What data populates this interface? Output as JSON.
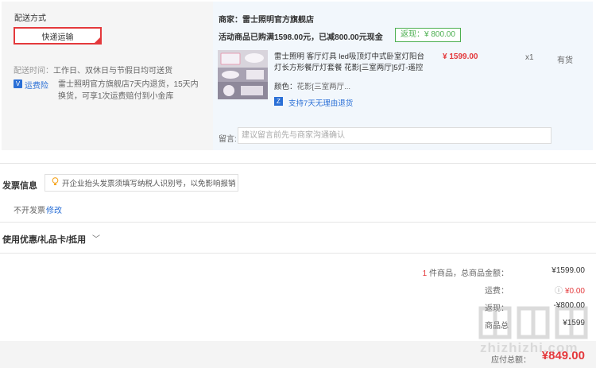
{
  "shipping": {
    "title": "配送方式",
    "method": "快递运输",
    "time_label": "配送时间：",
    "time_value": "工作日、双休日与节假日均可送货",
    "insurance_icon": "V",
    "insurance_label": "运费险",
    "insurance_desc": "雷士照明官方旗舰店7天内退货，15天内换货，可享1次运费赔付到小金库"
  },
  "shop": {
    "name": "商家：雷士照明官方旗舰店",
    "promo": "活动商品已购满1598.00元，已减800.00元现金",
    "rebate": "返现：¥ 800.00"
  },
  "product": {
    "name": "雷士照明 客厅灯具 led吸顶灯中式卧室灯阳台灯长方形餐厅灯套餐 花影[三室两厅]5灯-遥控",
    "color_label": "颜色：",
    "color_value": "花影[三室两厅...",
    "price": "¥ 1599.00",
    "qty": "x1",
    "stock": "有货",
    "return_icon": "Z",
    "return_text": "支持7天无理由退货"
  },
  "note": {
    "label": "留言:",
    "placeholder": "建议留言前先与商家沟通确认"
  },
  "invoice": {
    "title": "发票信息",
    "tip": "开企业抬头发票须填写纳税人识别号，以免影响报销",
    "value": "不开发票",
    "edit": "修改"
  },
  "coupon": {
    "title": "使用优惠/礼品卡/抵用",
    "arrow": "﹀"
  },
  "summary": {
    "count": "1",
    "count_suffix": " 件商品，总商品金额：",
    "total": "¥1599.00",
    "freight_label": "运费：",
    "freight_icon": "ⓘ",
    "freight": "¥0.00",
    "rebate_label": "返现：",
    "rebate": "-¥800.00",
    "goods_label": "商品总",
    "goods": "¥1599"
  },
  "pay": {
    "label": "应付总额：",
    "value": "¥849.00"
  },
  "watermark": {
    "text": "zhizhizhi.com"
  },
  "colors": {
    "accent": "#e4393c",
    "link": "#2a6fd6",
    "rebate": "#4caf50"
  }
}
